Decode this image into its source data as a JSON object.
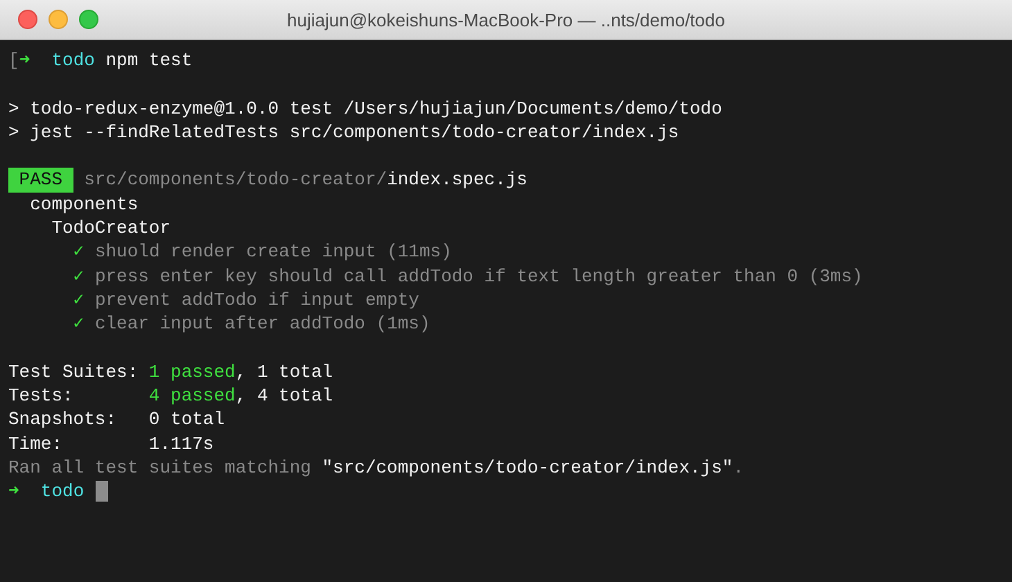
{
  "window": {
    "title": "hujiajun@kokeishuns-MacBook-Pro — ..nts/demo/todo"
  },
  "terminal": {
    "blocks": [
      [
        {
          "segments": [
            {
              "kind": "dim",
              "text": "["
            },
            {
              "kind": "arrow",
              "text": "➜"
            },
            {
              "kind": "dir",
              "text": "  todo"
            },
            {
              "kind": "text",
              "text": " npm test"
            }
          ]
        }
      ],
      [
        {
          "segments": [
            {
              "kind": "text",
              "text": "> todo-redux-enzyme@1.0.0 test /Users/hujiajun/Documents/demo/todo"
            }
          ]
        },
        {
          "segments": [
            {
              "kind": "text",
              "text": "> jest --findRelatedTests src/components/todo-creator/index.js"
            }
          ]
        }
      ],
      [
        {
          "segments": [
            {
              "kind": "badge",
              "text": " PASS "
            },
            {
              "kind": "dim",
              "text": " src/components/todo-creator/"
            },
            {
              "kind": "text",
              "text": "index.spec.js"
            }
          ]
        },
        {
          "segments": [
            {
              "kind": "text",
              "text": "  components"
            }
          ]
        },
        {
          "segments": [
            {
              "kind": "text",
              "text": "    TodoCreator"
            }
          ]
        },
        {
          "segments": [
            {
              "kind": "check",
              "text": "      ✓"
            },
            {
              "kind": "dim",
              "text": " shuold render create input (11ms)"
            }
          ]
        },
        {
          "segments": [
            {
              "kind": "check",
              "text": "      ✓"
            },
            {
              "kind": "dim",
              "text": " press enter key should call addTodo if text length greater than 0 (3ms)"
            }
          ]
        },
        {
          "segments": [
            {
              "kind": "check",
              "text": "      ✓"
            },
            {
              "kind": "dim",
              "text": " prevent addTodo if input empty"
            }
          ]
        },
        {
          "segments": [
            {
              "kind": "check",
              "text": "      ✓"
            },
            {
              "kind": "dim",
              "text": " clear input after addTodo (1ms)"
            }
          ]
        }
      ],
      [
        {
          "segments": [
            {
              "kind": "text",
              "text": "Test Suites: "
            },
            {
              "kind": "green",
              "text": "1 passed"
            },
            {
              "kind": "text",
              "text": ", 1 total"
            }
          ]
        },
        {
          "segments": [
            {
              "kind": "text",
              "text": "Tests:       "
            },
            {
              "kind": "green",
              "text": "4 passed"
            },
            {
              "kind": "text",
              "text": ", 4 total"
            }
          ]
        },
        {
          "segments": [
            {
              "kind": "text",
              "text": "Snapshots:   0 total"
            }
          ]
        },
        {
          "segments": [
            {
              "kind": "text",
              "text": "Time:        1.117s"
            }
          ]
        },
        {
          "segments": [
            {
              "kind": "dim",
              "text": "Ran all test suites matching "
            },
            {
              "kind": "text",
              "text": "\"src/components/todo-creator/index.js\""
            },
            {
              "kind": "dim",
              "text": "."
            }
          ]
        },
        {
          "segments": [
            {
              "kind": "arrow",
              "text": "➜"
            },
            {
              "kind": "dir",
              "text": "  todo"
            }
          ],
          "cursor": true
        }
      ]
    ]
  }
}
